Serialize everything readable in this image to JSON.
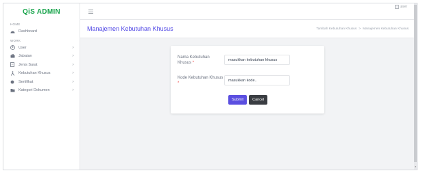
{
  "brand": "QiS ADMIN",
  "sidebar": {
    "section_home": "HOME",
    "section_work": "WORK",
    "items_home": [
      {
        "label": "Dashboard",
        "icon": "dashboard-icon"
      }
    ],
    "items_work": [
      {
        "label": "User",
        "icon": "user-icon"
      },
      {
        "label": "Jabatan",
        "icon": "briefcase-icon"
      },
      {
        "label": "Jenis Surat",
        "icon": "document-icon"
      },
      {
        "label": "Kebutuhan Khusus",
        "icon": "accessibility-icon"
      },
      {
        "label": "Sertifikat",
        "icon": "certificate-icon"
      },
      {
        "label": "Kategori Dokumen",
        "icon": "folder-icon"
      }
    ]
  },
  "topbar": {
    "user_alt": "user"
  },
  "page": {
    "title": "Manajemen Kebutuhan Khusus",
    "breadcrumb": [
      "Tambah Kebutuhan Khusus",
      "Manajemen Kebutuhan Khusus"
    ],
    "breadcrumb_sep": ">"
  },
  "form": {
    "fields": [
      {
        "label": "Nama Kebutuhan Khusus",
        "required": "*",
        "placeholder": "masukkan kebutuhan khusus"
      },
      {
        "label": "Kode Kebutuhan Khusus",
        "required": "*",
        "placeholder": "masukkan kode.."
      }
    ],
    "submit_label": "Submit",
    "cancel_label": "Cancel"
  },
  "colors": {
    "brand": "#16a34a",
    "accent": "#4f46e5",
    "submit": "#5b4fe0",
    "cancel": "#3a3d42",
    "required": "#ef4444"
  }
}
